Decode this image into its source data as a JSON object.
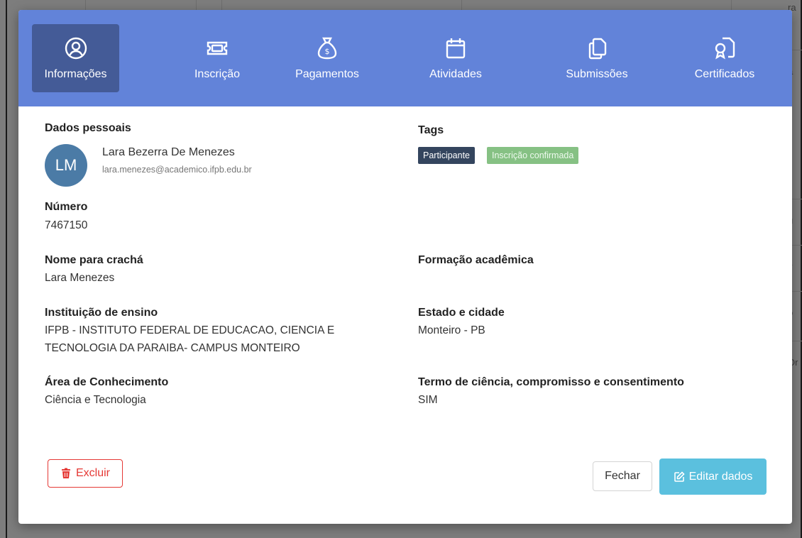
{
  "background": {
    "right_fragments": [
      "ra",
      "a",
      "u",
      "v",
      "o",
      "Or"
    ]
  },
  "tabs": [
    {
      "label": "Informações",
      "icon": "user-circle-icon",
      "active": true
    },
    {
      "label": "Inscrição",
      "icon": "ticket-icon",
      "active": false
    },
    {
      "label": "Pagamentos",
      "icon": "money-bag-icon",
      "active": false
    },
    {
      "label": "Atividades",
      "icon": "calendar-icon",
      "active": false
    },
    {
      "label": "Submissões",
      "icon": "copy-icon",
      "active": false
    },
    {
      "label": "Certificados",
      "icon": "certificate-icon",
      "active": false
    }
  ],
  "personal": {
    "section_label": "Dados pessoais",
    "avatar_initials": "LM",
    "name": "Lara Bezerra De Menezes",
    "email": "lara.menezes@academico.ifpb.edu.br"
  },
  "tags": {
    "label": "Tags",
    "items": [
      "Participante",
      "Inscrição confirmada"
    ]
  },
  "fields": {
    "numero_label": "Número",
    "numero_value": "7467150",
    "cracha_label": "Nome para crachá",
    "cracha_value": "Lara Menezes",
    "formacao_label": "Formação acadêmica",
    "formacao_value": "",
    "instituicao_label": "Instituição de ensino",
    "instituicao_value_line1": "IFPB - INSTITUTO FEDERAL DE EDUCACAO, CIENCIA E",
    "instituicao_value_line2": "TECNOLOGIA DA PARAIBA- CAMPUS MONTEIRO",
    "estado_label": "Estado e cidade",
    "estado_value": "Monteiro - PB",
    "area_label": "Área de Conhecimento",
    "area_value": "Ciência e Tecnologia",
    "termo_label": "Termo de ciência, compromisso e consentimento",
    "termo_value": "SIM"
  },
  "actions": {
    "delete_label": "Excluir",
    "close_label": "Fechar",
    "edit_label": "Editar dados"
  },
  "colors": {
    "tabbar": "#6283d9",
    "tab_active": "#445b97",
    "danger": "#e53935",
    "info": "#5bc0de",
    "tag_dark": "#34455e",
    "tag_green": "#86c184",
    "avatar": "#4b7ba6"
  }
}
